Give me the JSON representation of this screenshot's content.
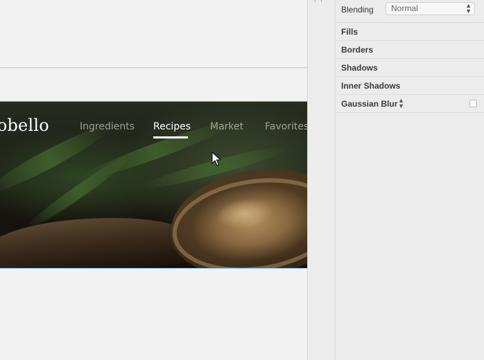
{
  "hero": {
    "brand": "tobello",
    "nav": [
      {
        "label": "Ingredients",
        "active": false
      },
      {
        "label": "Recipes",
        "active": true
      },
      {
        "label": "Market",
        "active": false
      },
      {
        "label": "Favorites",
        "active": false
      }
    ]
  },
  "inspector": {
    "blending": {
      "label": "Blending",
      "value": "Normal"
    },
    "sections": [
      {
        "label": "Fills"
      },
      {
        "label": "Borders"
      },
      {
        "label": "Shadows"
      },
      {
        "label": "Inner Shadows"
      },
      {
        "label": "Gaussian Blur",
        "checked": false
      }
    ]
  },
  "icons": {
    "cursor": "pointer-arrow-icon",
    "select": "up-down-chevrons-icon",
    "splitter": "resize-handle-icon"
  },
  "colors": {
    "selection": "#6fb0e2",
    "active_nav": "#ffffff"
  }
}
